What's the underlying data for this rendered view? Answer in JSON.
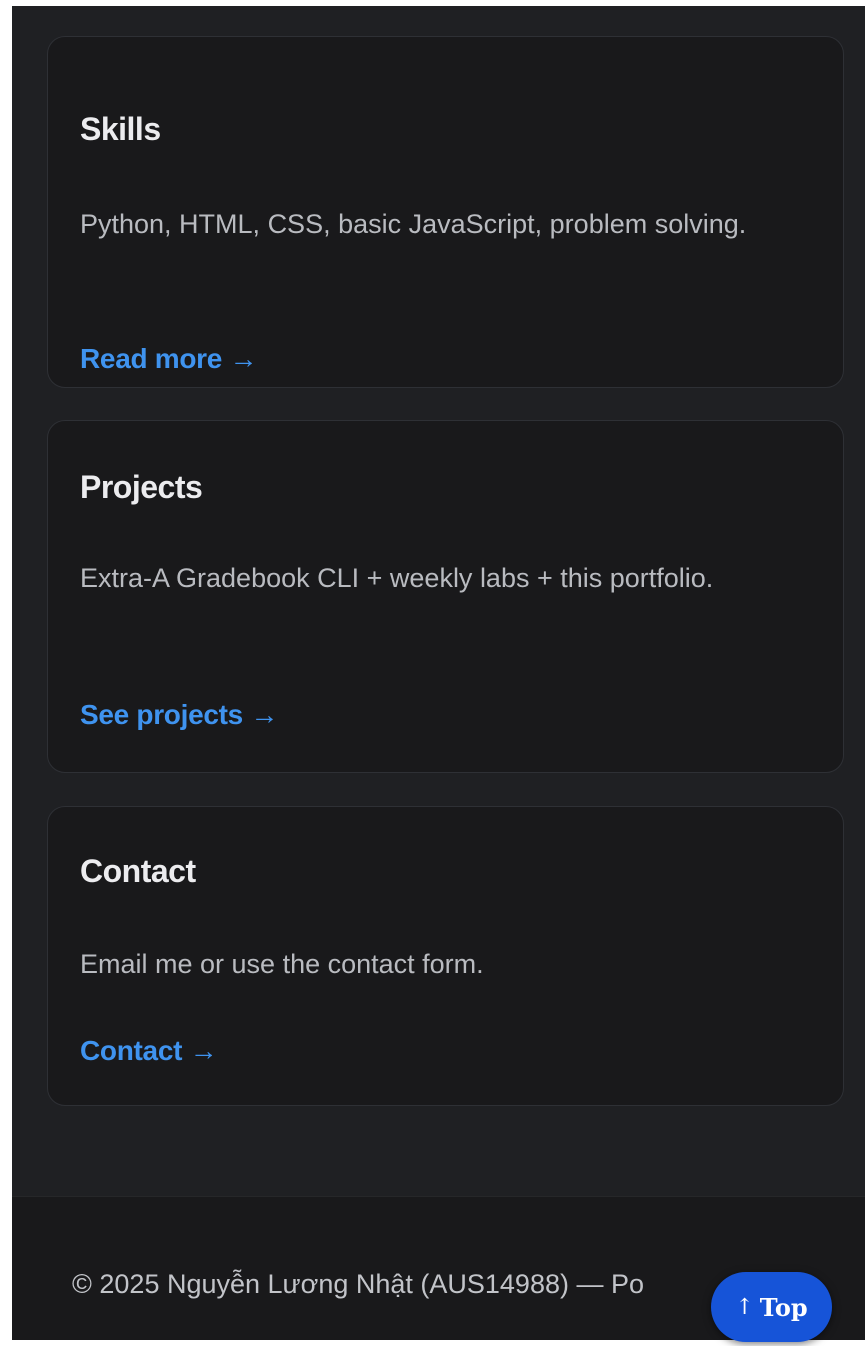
{
  "cards": [
    {
      "title": "Skills",
      "body": "Python, HTML, CSS, basic JavaScript, problem solving.",
      "link": "Read more →"
    },
    {
      "title": "Projects",
      "body": "Extra-A Gradebook CLI + weekly labs + this portfolio.",
      "link": "See projects →"
    },
    {
      "title": "Contact",
      "body": "Email me or use the contact form.",
      "link": "Contact →"
    }
  ],
  "footer": {
    "text": "© 2025 Nguyễn Lương Nhật (AUS14988) — Po"
  },
  "top_button": {
    "arrow": "↑",
    "label": "Top"
  },
  "colors": {
    "background": "#1f2023",
    "card": "#19191b",
    "link": "#3f93ef",
    "top_button": "#1654d8"
  }
}
